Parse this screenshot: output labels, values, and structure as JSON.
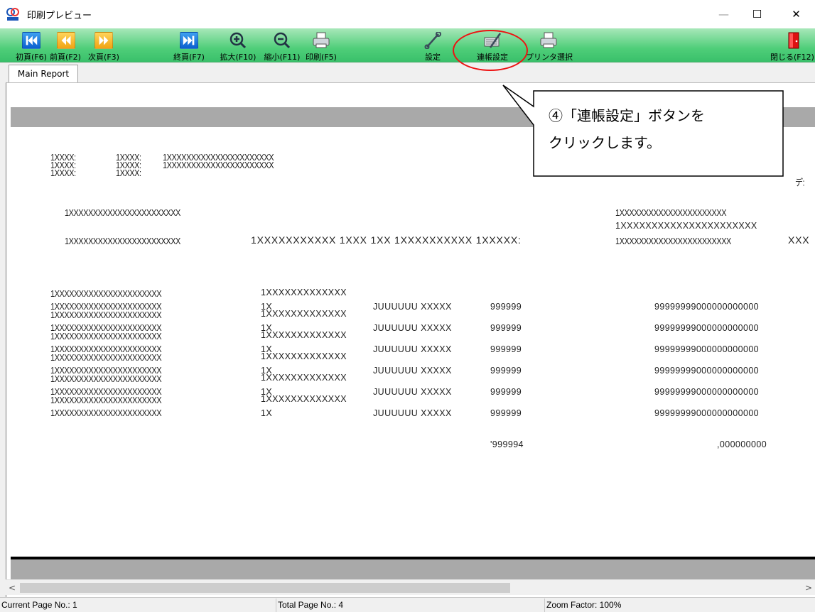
{
  "window": {
    "title": "印刷プレビュー",
    "controls": {
      "minimize": "—",
      "maximize": "☐",
      "close": "✕"
    }
  },
  "toolbar": {
    "buttons": [
      {
        "label": "初頁(F6)",
        "icon": "first-page-icon"
      },
      {
        "label": "前頁(F2)",
        "icon": "previous-page-icon"
      },
      {
        "label": "次頁(F3)",
        "icon": "next-page-icon"
      },
      {
        "label": "終頁(F7)",
        "icon": "last-page-icon"
      },
      {
        "label": "拡大(F10)",
        "icon": "zoom-in-icon"
      },
      {
        "label": "縮小(F11)",
        "icon": "zoom-out-icon"
      },
      {
        "label": "印刷(F5)",
        "icon": "printer-icon"
      },
      {
        "label": "設定",
        "icon": "wrench-icon"
      },
      {
        "label": "連帳設定",
        "icon": "continuous-form-settings-icon"
      },
      {
        "label": "プリンタ選択",
        "icon": "printer-select-icon"
      },
      {
        "label": "閉じる(F12)",
        "icon": "exit-door-icon"
      }
    ]
  },
  "tabs": [
    {
      "label": "Main Report"
    }
  ],
  "report": {
    "header_col1": [
      "1XXXX:",
      "1XXXX:",
      "1XXXX:"
    ],
    "header_col2": [
      "1XXXX:",
      "1XXXX:",
      "1XXXX:"
    ],
    "header_col3": [
      "1XXXXXXXXXXXXXXXXXXXXXX",
      "1XXXXXXXXXXXXXXXXXXXXXX"
    ],
    "header_right": "デ:",
    "addr_left_1": "1XXXXXXXXXXXXXXXXXXXXXXX",
    "addr_left_2": "1XXXXXXXXXXXXXXXXXXXXXXX",
    "addr_middle": "1XXXXXXXXXXX 1XXX 1XX 1XXXXXXXXXX  1XXXXX:",
    "addr_right_1": "1XXXXXXXXXXXXXXXXXXXXXX",
    "addr_right_2": "1XXXXXXXXXXXXXXXXXXXXXX",
    "addr_right_3": "1XXXXXXXXXXXXXXXXXXXXXXX",
    "addr_right_edge": "XXX",
    "rows": [
      {
        "name_a": "1XXXXXXXXXXXXXXXXXXXXXX",
        "name_b": "1XXXXXXXXXXXXXXXXXXXXXX",
        "code": "1XXXXXXXXXXXXX",
        "code2": "1X",
        "unit": "JUUUUUU XXXXX",
        "qty": "999999",
        "amount": "99999999000000000000"
      },
      {
        "name_a": "1XXXXXXXXXXXXXXXXXXXXXX",
        "name_b": "1XXXXXXXXXXXXXXXXXXXXXX",
        "code": "1XXXXXXXXXXXXX",
        "code2": "1X",
        "unit": "JUUUUUU XXXXX",
        "qty": "999999",
        "amount": "99999999000000000000"
      },
      {
        "name_a": "1XXXXXXXXXXXXXXXXXXXXXX",
        "name_b": "1XXXXXXXXXXXXXXXXXXXXXX",
        "code": "1XXXXXXXXXXXXX",
        "code2": "1X",
        "unit": "JUUUUUU XXXXX",
        "qty": "999999",
        "amount": "99999999000000000000"
      },
      {
        "name_a": "1XXXXXXXXXXXXXXXXXXXXXX",
        "name_b": "1XXXXXXXXXXXXXXXXXXXXXX",
        "code": "1XXXXXXXXXXXXX",
        "code2": "1X",
        "unit": "JUUUUUU XXXXX",
        "qty": "999999",
        "amount": "99999999000000000000"
      },
      {
        "name_a": "1XXXXXXXXXXXXXXXXXXXXXX",
        "name_b": "1XXXXXXXXXXXXXXXXXXXXXX",
        "code": "1XXXXXXXXXXXXX",
        "code2": "1X",
        "unit": "JUUUUUU XXXXX",
        "qty": "999999",
        "amount": "99999999000000000000"
      },
      {
        "name_a": "1XXXXXXXXXXXXXXXXXXXXXX",
        "name_b": "1XXXXXXXXXXXXXXXXXXXXXX",
        "code": "1XXXXXXXXXXXXX",
        "code2": "1X",
        "unit": "JUUUUUU XXXXX",
        "qty": "999999",
        "amount": "99999999000000000000"
      }
    ],
    "total_qty": "'999994",
    "total_amount": ",000000000"
  },
  "status": {
    "current_page": "Current Page No.: 1",
    "total_page": "Total Page No.: 4",
    "zoom": "Zoom Factor: 100%"
  },
  "scrollbar": {
    "left_arrow": "<",
    "right_arrow": ">"
  },
  "callout": {
    "line1": "④「連帳設定」ボタンを",
    "line2": "クリックします。"
  }
}
